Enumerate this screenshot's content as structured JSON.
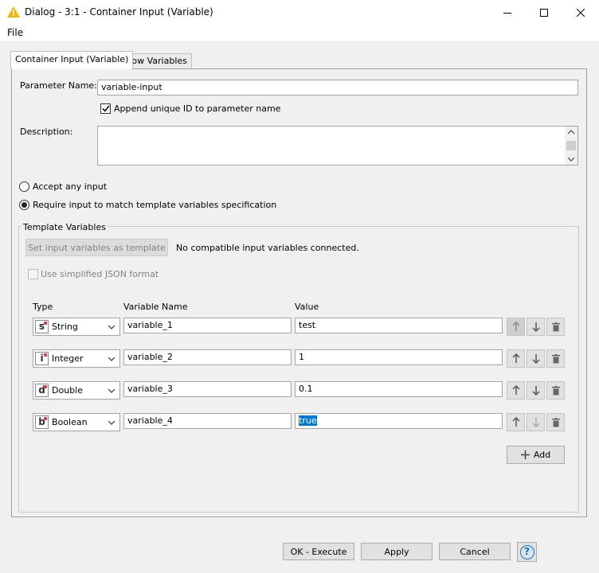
{
  "window": {
    "title": "Dialog - 3:1 - Container Input (Variable)",
    "menu_file": "File"
  },
  "tabs": [
    {
      "label": "Container Input (Variable)"
    },
    {
      "label": "Flow Variables"
    }
  ],
  "params": {
    "name_label": "Parameter Name:",
    "name_value": "variable-input",
    "append_id_label": "Append unique ID to parameter name",
    "description_label": "Description:",
    "accept_any_label": "Accept any input",
    "require_label": "Require input to match template variables specification"
  },
  "template": {
    "group_title": "Template Variables",
    "set_button": "Set input variables as template",
    "no_compat": "No compatible input variables connected.",
    "json_label": "Use simplified JSON format",
    "col_type": "Type",
    "col_name": "Variable Name",
    "col_value": "Value",
    "rows": [
      {
        "type_letter": "s",
        "type": "String",
        "name": "variable_1",
        "value": "test"
      },
      {
        "type_letter": "i",
        "type": "Integer",
        "name": "variable_2",
        "value": "1"
      },
      {
        "type_letter": "d",
        "type": "Double",
        "name": "variable_3",
        "value": "0.1"
      },
      {
        "type_letter": "b",
        "type": "Boolean",
        "name": "variable_4",
        "value": "true"
      }
    ],
    "add_button": "Add"
  },
  "footer": {
    "ok_execute": "OK - Execute",
    "apply": "Apply",
    "cancel": "Cancel",
    "help": "?"
  },
  "colors": {
    "accent": "#0078d7",
    "type_dot": "#e23b3b",
    "warning_icon": "#f2b807"
  }
}
